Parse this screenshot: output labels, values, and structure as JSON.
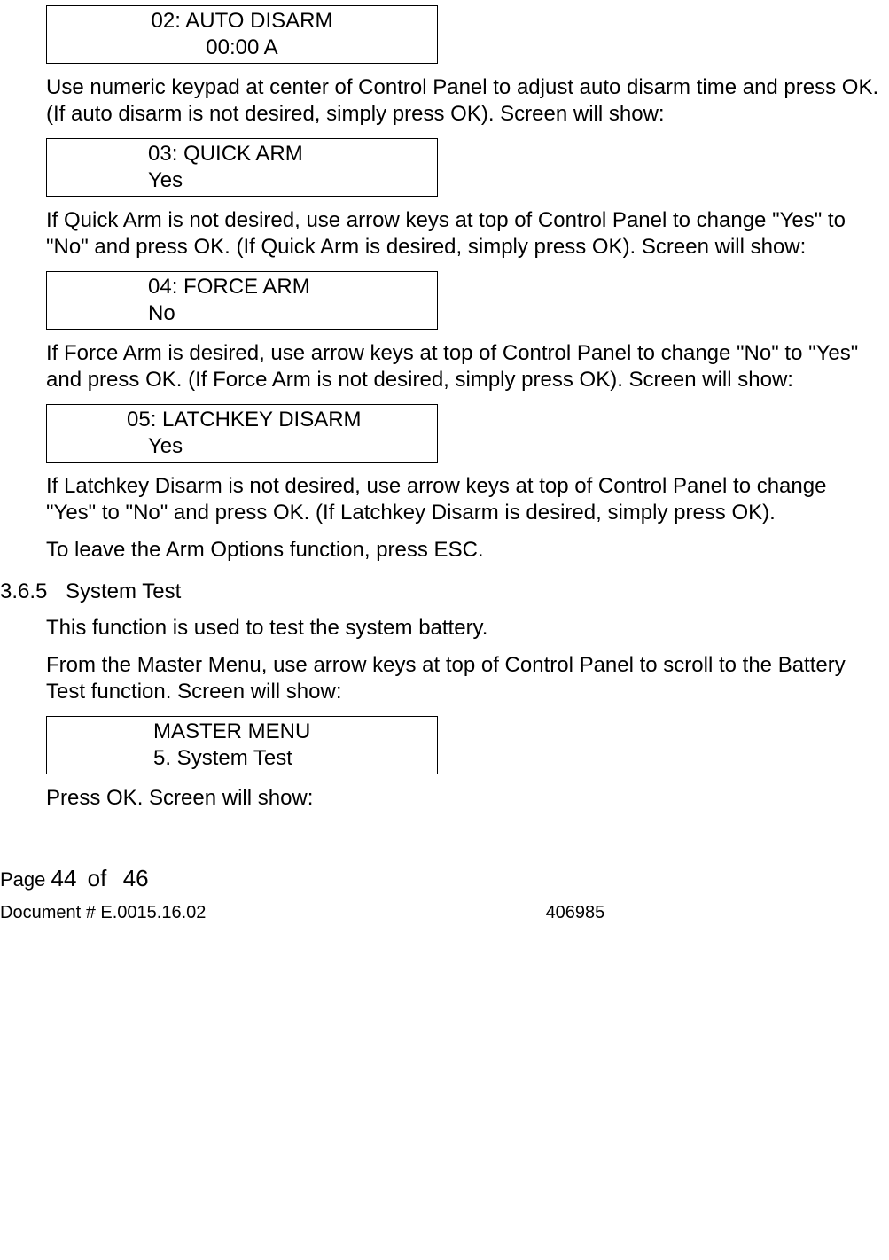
{
  "screens": {
    "s02": {
      "line1": "02: AUTO DISARM",
      "line2": "00:00 A"
    },
    "s03": {
      "line1": "03: QUICK ARM",
      "line2": "Yes"
    },
    "s04": {
      "line1": "04: FORCE ARM",
      "line2": "No"
    },
    "s05": {
      "line1": "05:  LATCHKEY DISARM",
      "line2": "Yes"
    },
    "master": {
      "line1": "MASTER MENU",
      "line2": "5. System Test"
    }
  },
  "paras": {
    "p1": "Use numeric keypad at center of Control Panel to adjust auto disarm time and press OK. (If auto disarm is not desired, simply press OK). Screen will show:",
    "p2": "If Quick Arm is not desired, use arrow keys at top of Control Panel to change \"Yes\" to \"No\" and press OK. (If Quick Arm is desired, simply press OK). Screen will show:",
    "p3": "If Force Arm is desired, use arrow keys at top of Control Panel to change \"No\" to \"Yes\" and press OK. (If Force Arm is not desired, simply press OK). Screen will show:",
    "p4": "If Latchkey Disarm is not desired, use arrow keys at top of Control Panel to change \"Yes\" to \"No\" and press OK. (If Latchkey Disarm is desired, simply press OK).",
    "p5": "To leave the Arm Options function, press ESC.",
    "p6": "This function is used to test the system battery.",
    "p7": "From the Master Menu, use arrow keys at top of Control Panel to scroll to the Battery Test function. Screen will show:",
    "p8": "Press OK. Screen will show:"
  },
  "section": {
    "number": "3.6.5",
    "title": "System Test"
  },
  "footer": {
    "page_label": "Page",
    "page_current": "44",
    "page_of": "of",
    "page_total": "46",
    "doc_label": "Document # E.0015.16.02",
    "doc_number": "406985"
  }
}
